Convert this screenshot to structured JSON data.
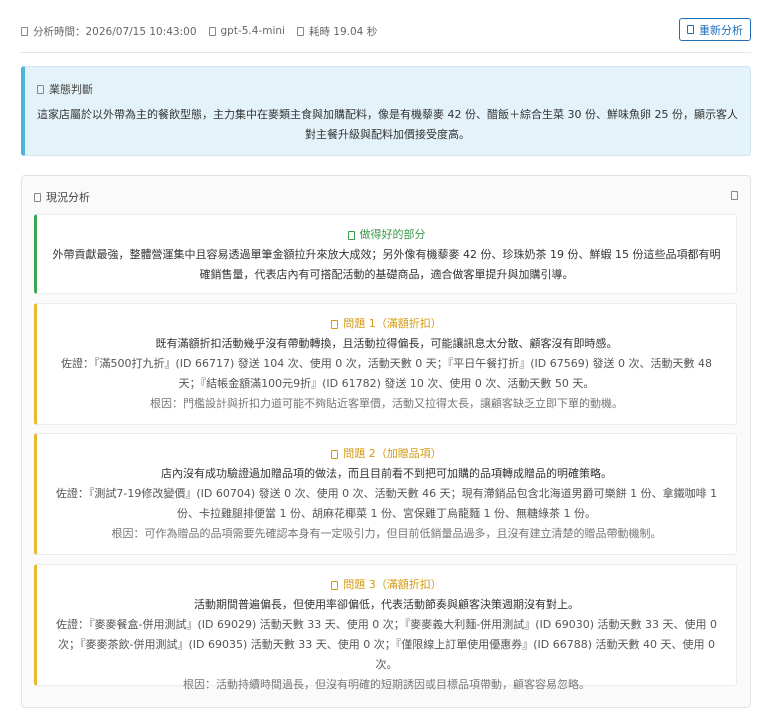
{
  "meta": {
    "analysis_time_label": "分析時間：2026/07/15 10:43:00",
    "model": "gpt-5.4-mini",
    "duration_label": "耗時 19.04 秒",
    "reanalyze_label": "重新分析"
  },
  "business": {
    "title": "業態判斷",
    "text": "這家店屬於以外帶為主的餐飲型態，主力集中在麥類主食與加購配料，像是有機藜麥 42 份、醋飯＋綜合生菜 30 份、鮮味魚卵 25 份，顯示客人對主餐升級與配料加價接受度高。"
  },
  "analysis": {
    "title": "現況分析",
    "good": {
      "title": "做得好的部分",
      "text": "外帶貢獻最強，整體營運集中且容易透過單筆金額拉升來放大成效；另外像有機藜麥 42 份、珍珠奶茶 19 份、鮮蝦 15 份這些品項都有明確銷售量，代表店內有可搭配活動的基礎商品，適合做客單提升與加購引導。"
    },
    "issues": [
      {
        "title": "問題 1（滿額折扣）",
        "main": "既有滿額折扣活動幾乎沒有帶動轉換，且活動拉得偏長，可能讓訊息太分散、顧客沒有即時感。",
        "evidence": "佐證：『滿500打九折』(ID 66717) 發送 104 次、使用 0 次，活動天數 0 天；『平日午餐打折』(ID 67569) 發送 0 次、活動天數 48 天；『結帳金額滿100元9折』(ID 61782) 發送 10 次、使用 0 次、活動天數 50 天。",
        "cause": "根因：門檻設計與折扣力道可能不夠貼近客單價，活動又拉得太長，讓顧客缺乏立即下單的動機。"
      },
      {
        "title": "問題 2（加贈品項）",
        "main": "店內沒有成功驗證過加贈品項的做法，而且目前看不到把可加購的品項轉成贈品的明確策略。",
        "evidence": "佐證：『測試7-19修改變價』(ID 60704) 發送 0 次、使用 0 次、活動天數 46 天；現有滯銷品包含北海道男爵可樂餅 1 份、拿鐵咖啡 1 份、卡拉雞腿排便當 1 份、胡麻花椰菜 1 份、宮保雞丁烏龍麵 1 份、無糖綠茶 1 份。",
        "cause": "根因：可作為贈品的品項需要先確認本身有一定吸引力，但目前低銷量品過多，且沒有建立清楚的贈品帶動機制。"
      },
      {
        "title": "問題 3（滿額折扣）",
        "main": "活動期間普遍偏長，但使用率卻偏低，代表活動節奏與顧客決策週期沒有對上。",
        "evidence": "佐證：『麥麥餐盒-併用測試』(ID 69029) 活動天數 33 天、使用 0 次；『麥麥義大利麵-併用測試』(ID 69030) 活動天數 33 天、使用 0 次；『麥麥茶飲-併用測試』(ID 69035) 活動天數 33 天、使用 0 次；『僅限線上訂單使用優惠券』(ID 66788) 活動天數 40 天、使用 0 次。",
        "cause": "根因：活動持續時間過長，但沒有明確的短期誘因或目標品項帶動，顧客容易忽略。"
      }
    ]
  }
}
